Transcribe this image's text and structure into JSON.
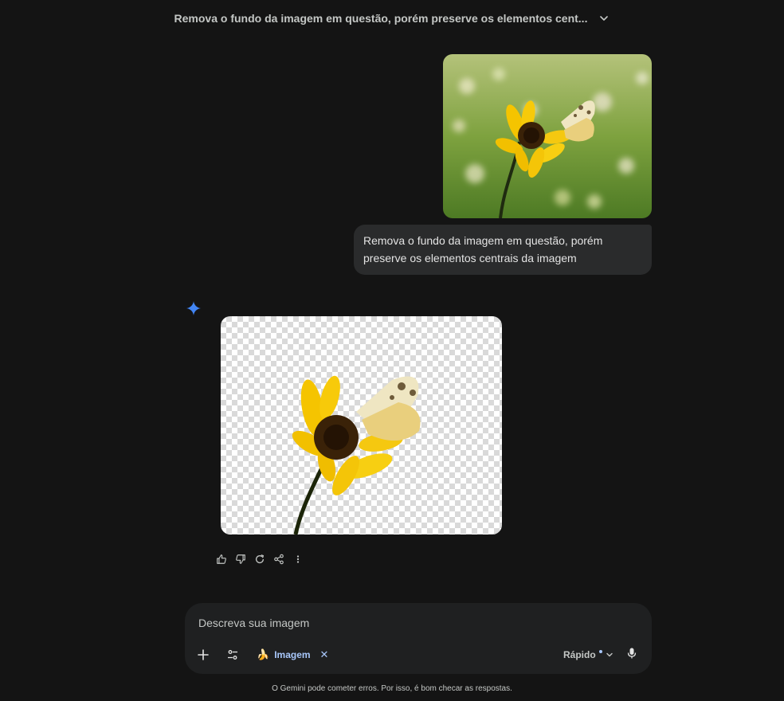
{
  "header": {
    "title": "Remova o fundo da imagem em questão, porém preserve os elementos cent..."
  },
  "user_message": {
    "image_icon": "photo-flower-butterfly",
    "text": "Remova o fundo da imagem em questão, porém preserve os elementos centrais da imagem"
  },
  "response": {
    "avatar_icon": "gemini-sparkle-icon",
    "image_icon": "photo-flower-butterfly-transparent",
    "actions": [
      "thumbs-up-icon",
      "thumbs-down-icon",
      "redo-icon",
      "share-icon",
      "more-vert-icon"
    ]
  },
  "composer": {
    "placeholder": "Descreva sua imagem",
    "tool_chip": {
      "emoji": "🍌",
      "label": "Imagem",
      "close": "✕"
    },
    "mode_label": "Rápido"
  },
  "footer": {
    "disclaimer": "O Gemini pode cometer erros. Por isso, é bom checar as respostas."
  },
  "colors": {
    "background": "#141414",
    "bubble": "#2a2b2c",
    "composer": "#1f2021",
    "accent": "#a8c7fa",
    "gemini_blue": "#4285f4"
  }
}
